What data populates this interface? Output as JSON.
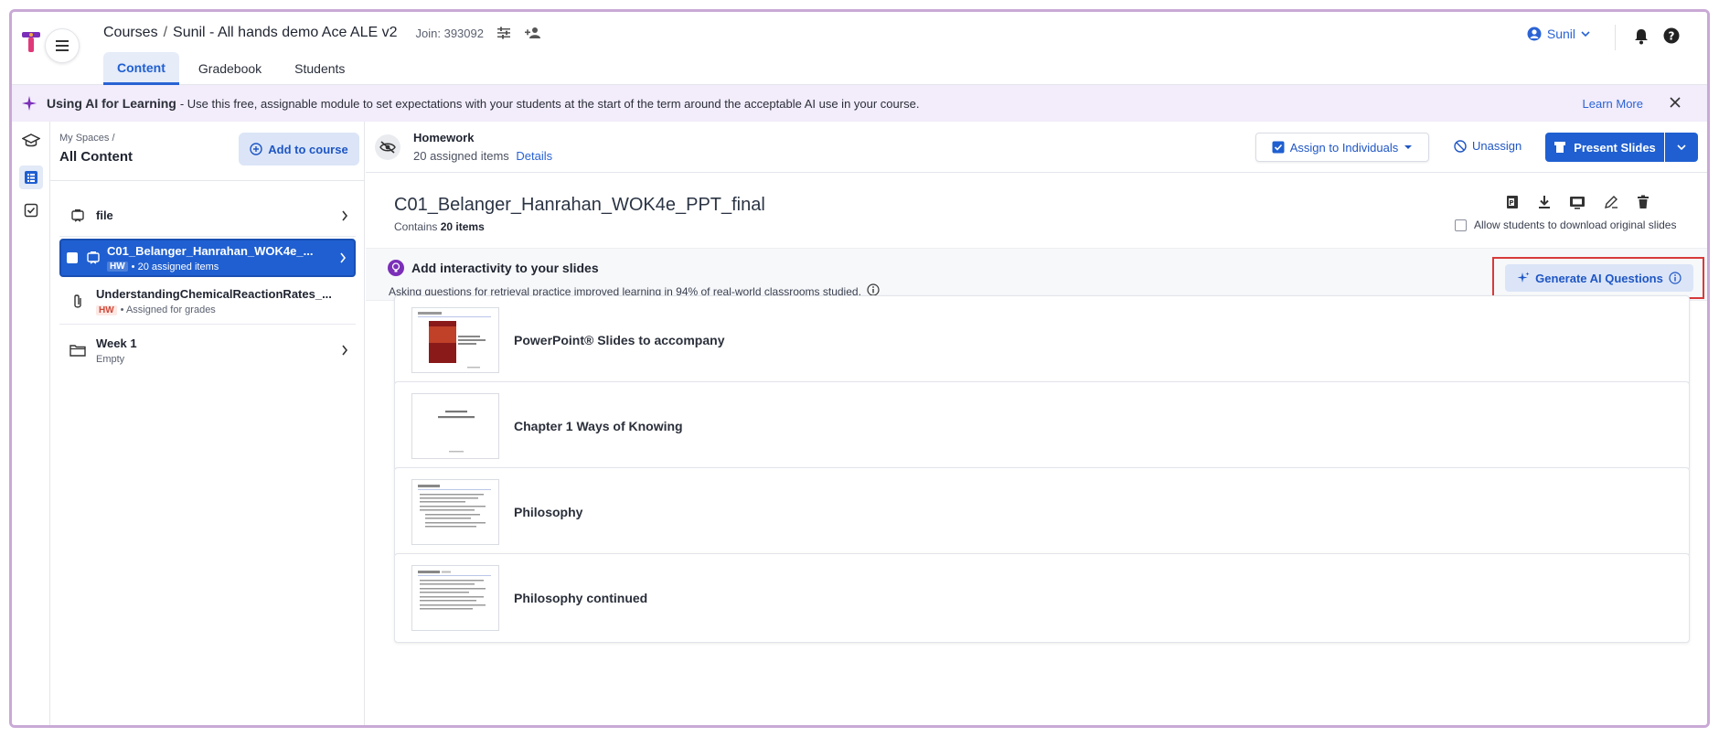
{
  "header": {
    "breadcrumb_courses": "Courses",
    "breadcrumb_sep": "/",
    "course_name": "Sunil - All hands demo Ace ALE v2",
    "join_code": "Join: 393092",
    "user_name": "Sunil"
  },
  "tabs": [
    {
      "label": "Content",
      "active": true
    },
    {
      "label": "Gradebook",
      "active": false
    },
    {
      "label": "Students",
      "active": false
    }
  ],
  "banner": {
    "title": "Using AI for Learning",
    "text": "- Use this free, assignable module to set expectations with your students at the start of the term around the acceptable AI use in your course.",
    "link": "Learn More"
  },
  "left_panel": {
    "subtitle": "My Spaces /",
    "title": "All Content",
    "add_button": "Add to course",
    "items": [
      {
        "name": "file",
        "meta": "",
        "icon": "presentation-icon",
        "selected": false
      },
      {
        "name": "C01_Belanger_Hanrahan_WOK4e_...",
        "badge": "HW",
        "meta": "• 20 assigned items",
        "icon": "presentation-icon",
        "selected": true
      },
      {
        "name": "UnderstandingChemicalReactionRates_...",
        "badge": "HW",
        "meta": "• Assigned for grades",
        "icon": "paperclip-icon",
        "selected": false
      },
      {
        "name": "Week 1",
        "meta": "Empty",
        "icon": "folder-icon",
        "selected": false
      }
    ]
  },
  "main": {
    "homework_title": "Homework",
    "homework_count": "20 assigned items",
    "details_link": "Details",
    "assign_button": "Assign to Individuals",
    "unassign_button": "Unassign",
    "present_button": "Present Slides",
    "doc_title": "C01_Belanger_Hanrahan_WOK4e_PPT_final",
    "contains_prefix": "Contains",
    "contains_count": "20 items",
    "download_label": "Allow students to download original slides",
    "ai_title": "Add interactivity to your slides",
    "ai_sub": "Asking questions for retrieval practice improved learning in 94% of real-world classrooms studied.",
    "generate_button": "Generate AI Questions"
  },
  "slides": [
    {
      "label": "PowerPoint® Slides to accompany"
    },
    {
      "label": "Chapter 1 Ways of Knowing"
    },
    {
      "label": "Philosophy"
    },
    {
      "label": "Philosophy continued"
    }
  ],
  "colors": {
    "primary": "#1f5fd1",
    "banner_bg": "#f2ecfb",
    "highlight_border": "#d83a3a",
    "hw_badge": "#d04a3a"
  }
}
